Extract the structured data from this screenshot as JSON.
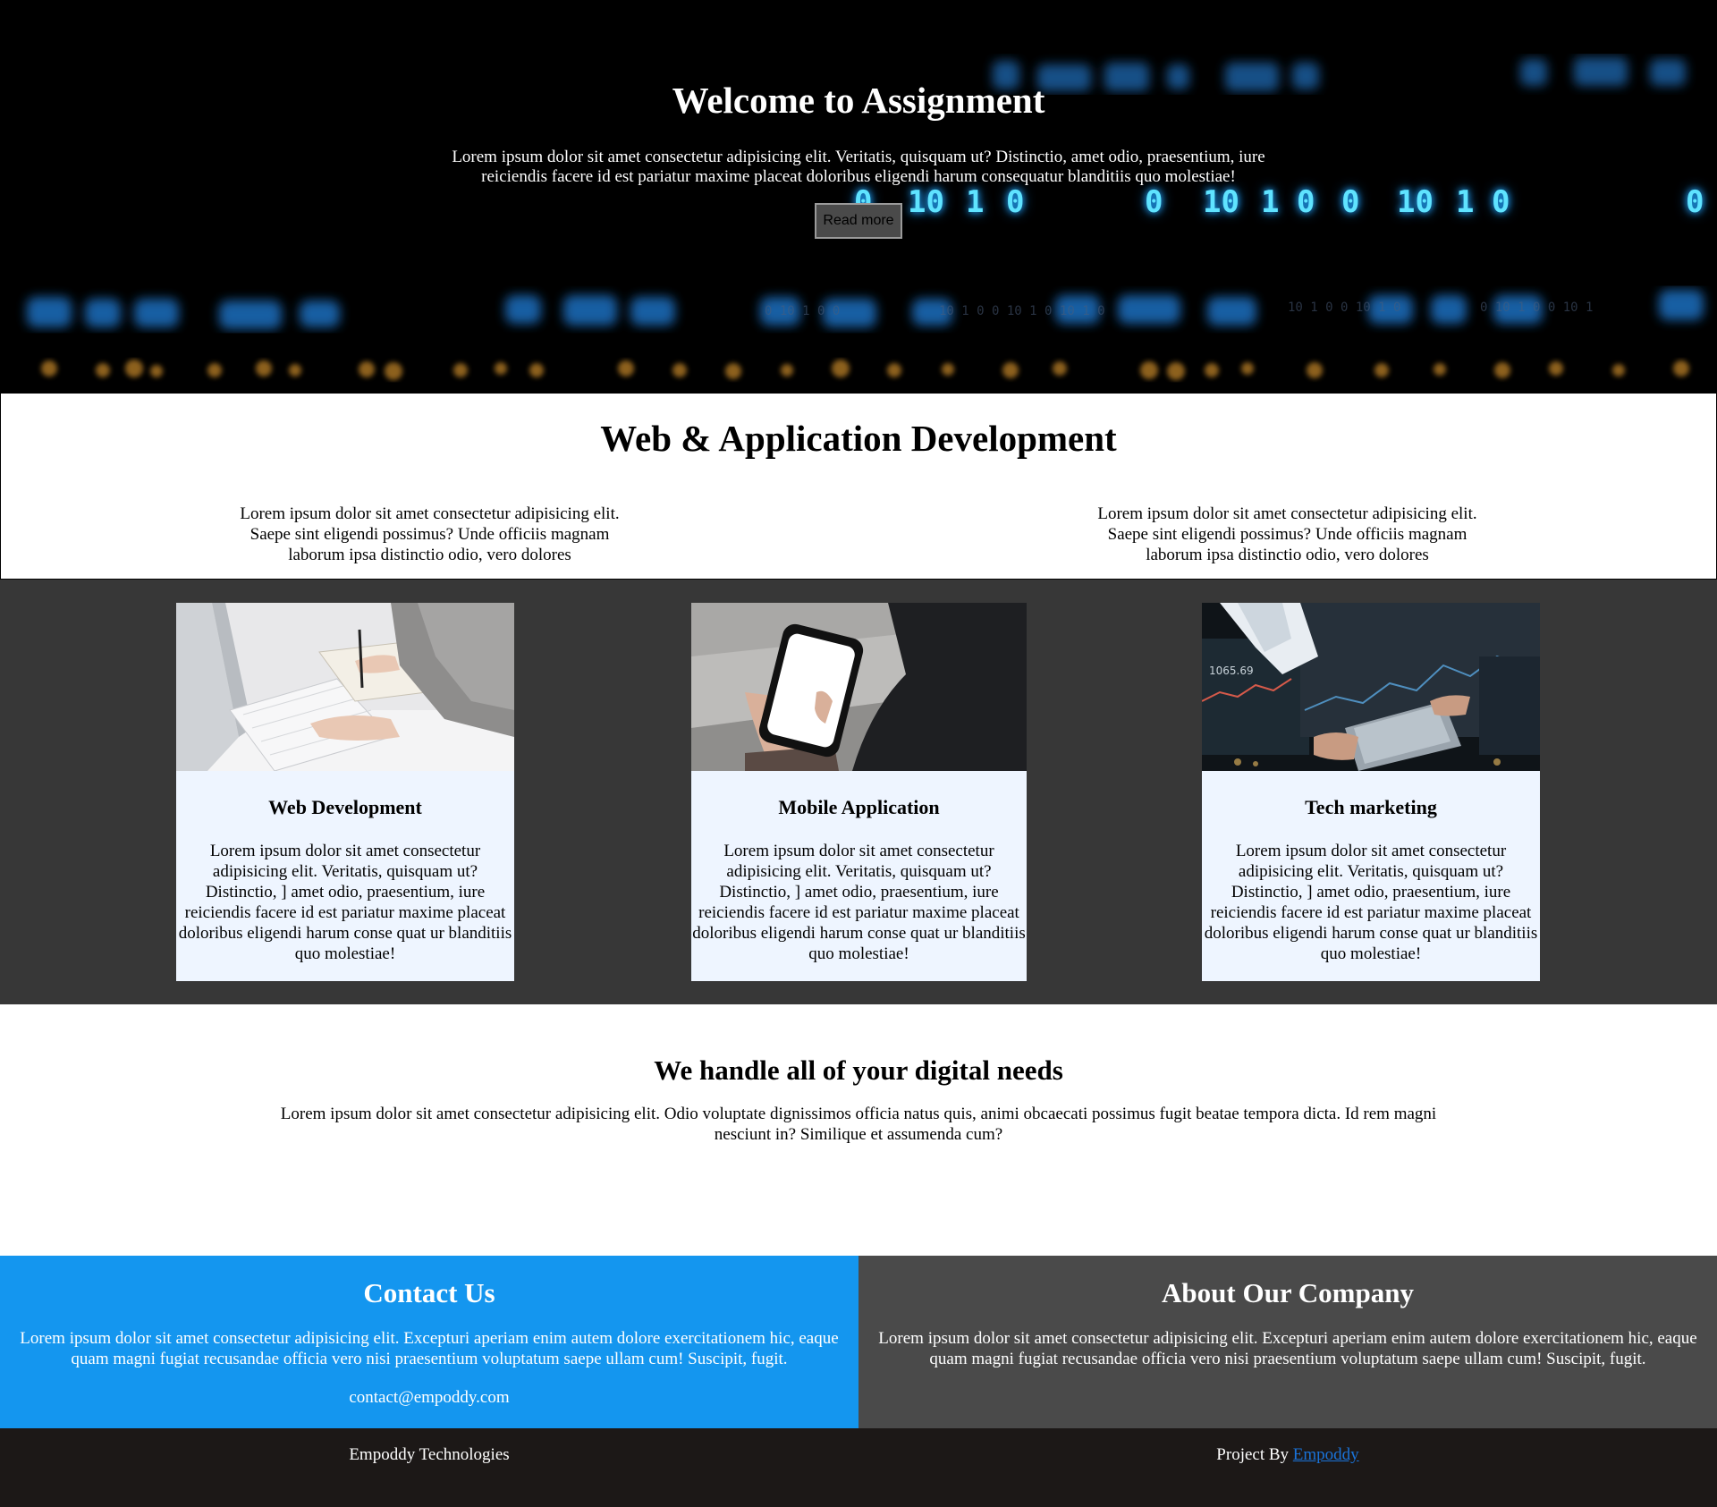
{
  "hero": {
    "title": "Welcome to Assignment",
    "text": "Lorem ipsum dolor sit amet consectetur adipisicing elit. Veritatis, quisquam ut? Distinctio, amet odio, praesentium, iure reiciendis facere id est pariatur maxime placeat doloribus eligendi harum consequatur blanditiis quo molestiae!",
    "button_label": "Read more",
    "background_digits": [
      "0",
      "10",
      "1",
      "0",
      "0",
      "10",
      "1",
      "0",
      "0",
      "10",
      "1",
      "0",
      "0"
    ]
  },
  "webapp": {
    "title": "Web & Application Development",
    "left_text": "Lorem ipsum dolor sit amet consectetur adipisicing elit. Saepe sint eligendi possimus? Unde officiis magnam laborum ipsa distinctio odio, vero dolores",
    "right_text": "Lorem ipsum dolor sit amet consectetur adipisicing elit. Saepe sint eligendi possimus? Unde officiis magnam laborum ipsa distinctio odio, vero dolores"
  },
  "cards": [
    {
      "title": "Web Development",
      "text": "Lorem ipsum dolor sit amet consectetur adipisicing elit. Veritatis, quisquam ut? Distinctio, ] amet odio, praesentium, iure reiciendis facere id est pariatur maxime placeat doloribus eligendi harum conse quat ur blanditiis quo molestiae!"
    },
    {
      "title": "Mobile Application",
      "text": "Lorem ipsum dolor sit amet consectetur adipisicing elit. Veritatis, quisquam ut? Distinctio, ] amet odio, praesentium, iure reiciendis facere id est pariatur maxime placeat doloribus eligendi harum conse quat ur blanditiis quo molestiae!"
    },
    {
      "title": "Tech marketing",
      "text": "Lorem ipsum dolor sit amet consectetur adipisicing elit. Veritatis, quisquam ut? Distinctio, ] amet odio, praesentium, iure reiciendis facere id est pariatur maxime placeat doloribus eligendi harum conse quat ur blanditiis quo molestiae!"
    }
  ],
  "digital": {
    "title": "We handle all of your digital needs",
    "text": "Lorem ipsum dolor sit amet consectetur adipisicing elit. Odio voluptate dignissimos officia natus quis, animi obcaecati possimus fugit beatae tempora dicta. Id rem magni nesciunt in? Similique et assumenda cum?"
  },
  "contact": {
    "title": "Contact Us",
    "text": "Lorem ipsum dolor sit amet consectetur adipisicing elit. Excepturi aperiam enim autem dolore exercitationem hic, eaque quam magni fugiat recusandae officia vero nisi praesentium voluptatum saepe ullam cum! Suscipit, fugit.",
    "email": "contact@empoddy.com"
  },
  "about": {
    "title": "About Our Company",
    "text": "Lorem ipsum dolor sit amet consectetur adipisicing elit. Excepturi aperiam enim autem dolore exercitationem hic, eaque quam magni fugiat recusandae officia vero nisi praesentium voluptatum saepe ullam cum! Suscipit, fugit."
  },
  "footer": {
    "company": "Empoddy Technologies",
    "project_prefix": "Project By ",
    "project_link": "Empoddy"
  },
  "colors": {
    "contact_bg": "#1496ef",
    "about_bg": "#4a4a4a",
    "cards_bg": "#373737",
    "card_bg": "#eef5ff",
    "footer_bg": "#1c1817",
    "link": "#1a73d9"
  }
}
